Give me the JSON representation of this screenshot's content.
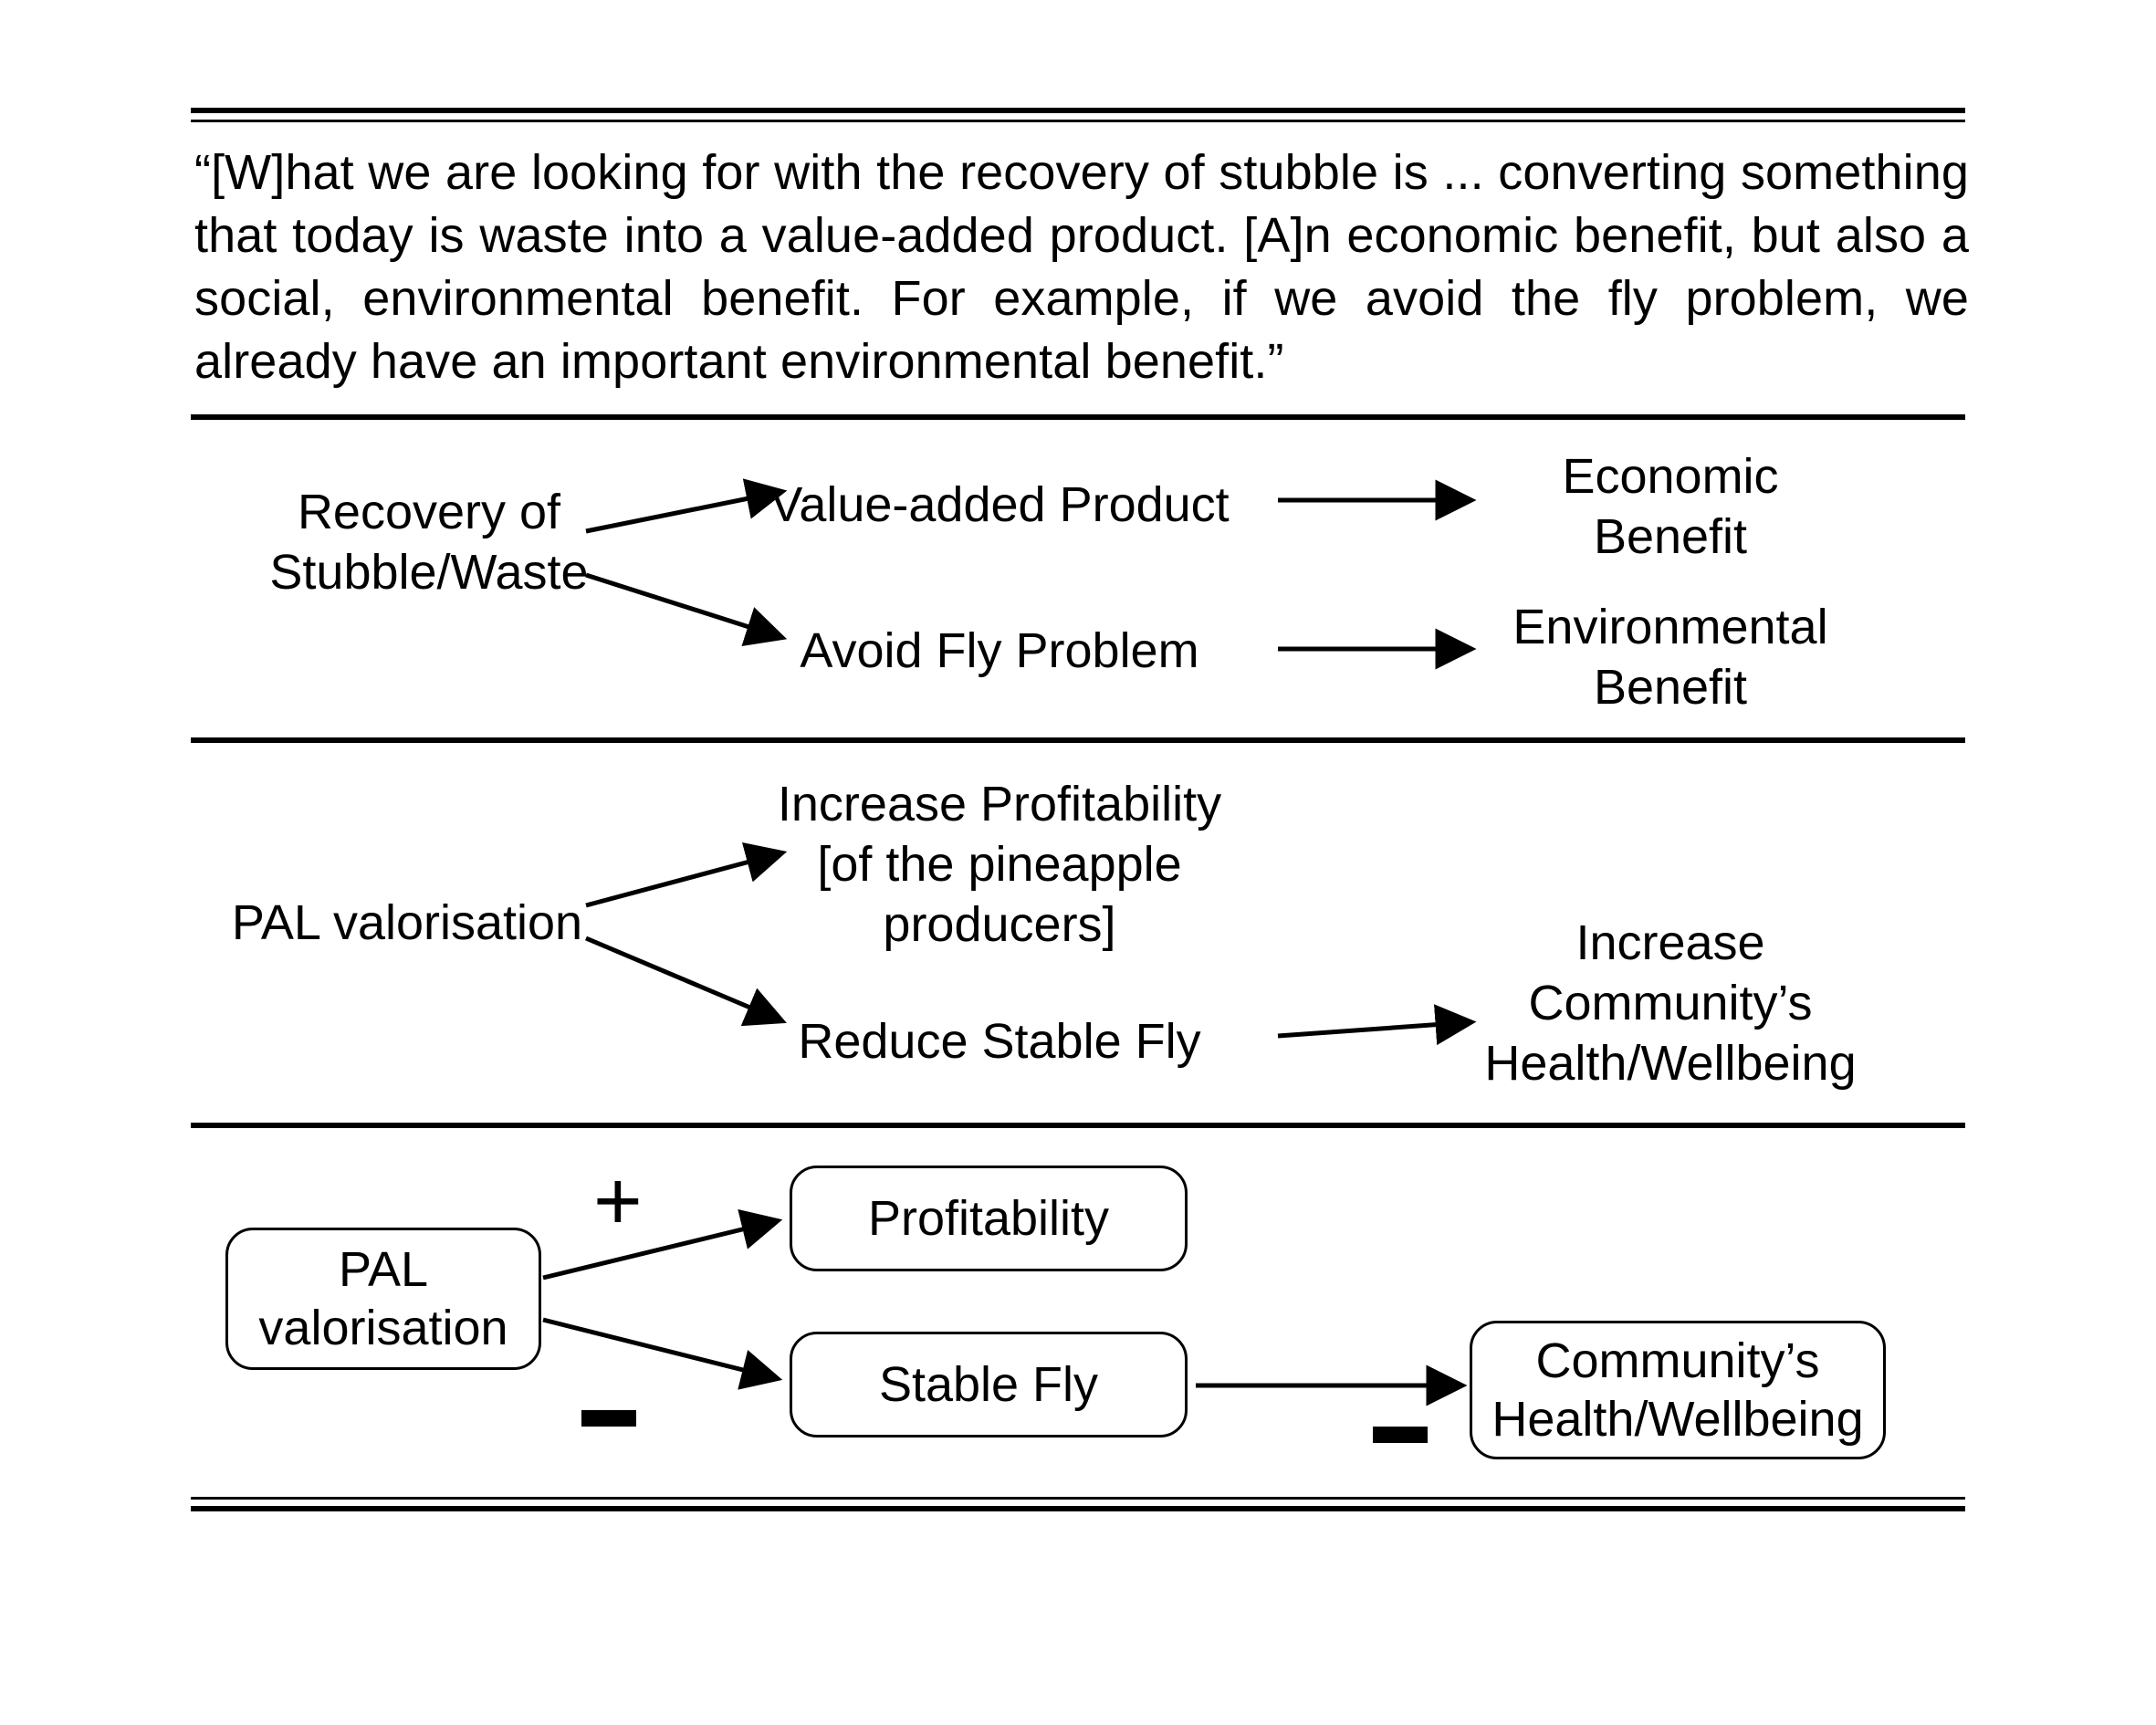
{
  "quote": "“[W]hat we are looking for with the recovery of stubble is ... converting something that today is waste into a value-added product. [A]n economic benefit, but also a social, environmental benefit. For example, if we avoid the fly problem, we already have an important environmental benefit.”",
  "section1": {
    "left": "Recovery of\nStubble/Waste",
    "mid_top": "Value-added Product",
    "mid_bot": "Avoid Fly Problem",
    "right_top": "Economic\nBenefit",
    "right_bot": "Environmental\nBenefit"
  },
  "section2": {
    "left": "PAL valorisation",
    "mid_top": "Increase Profitability\n[of the pineapple\nproducers]",
    "mid_bot": "Reduce Stable Fly",
    "right": "Increase\nCommunity’s\nHealth/Wellbeing"
  },
  "section3": {
    "left": "PAL\nvalorisation",
    "mid_top": "Profitability",
    "mid_bot": "Stable Fly",
    "right": "Community’s\nHealth/Wellbeing",
    "sign_plus": "+",
    "sign_minus_shape": "minus"
  }
}
